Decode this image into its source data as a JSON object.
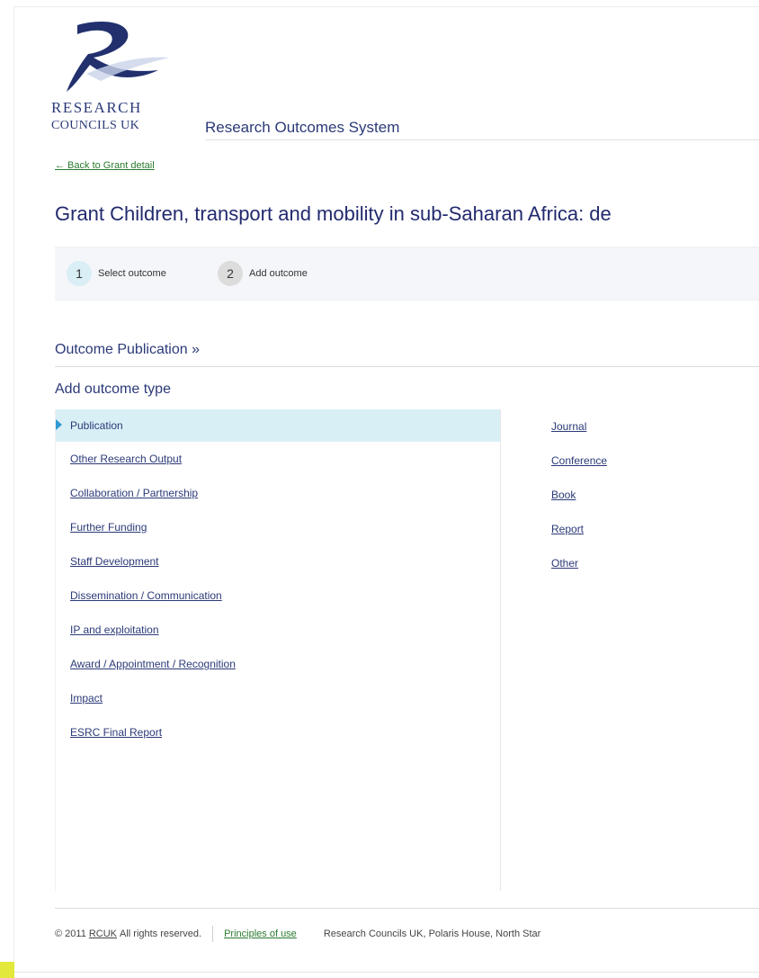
{
  "header": {
    "logo_line_1": "RESEARCH",
    "logo_line_2": "COUNCILS UK",
    "system_title": "Research Outcomes System",
    "logo_icon": "rcuk-swoosh-logo"
  },
  "nav": {
    "back_link": "← Back to Grant detail"
  },
  "grant": {
    "title": "Grant Children, transport and mobility in sub-Saharan Africa: de"
  },
  "steps": [
    {
      "number": "1",
      "label": "Select outcome"
    },
    {
      "number": "2",
      "label": "Add outcome"
    }
  ],
  "section": {
    "heading": "Outcome Publication »",
    "subheading": "Add outcome type"
  },
  "outcome_types": [
    {
      "label": "Publication",
      "selected": true
    },
    {
      "label": "Other Research Output",
      "selected": false
    },
    {
      "label": "Collaboration / Partnership",
      "selected": false
    },
    {
      "label": "Further Funding",
      "selected": false
    },
    {
      "label": "Staff Development",
      "selected": false
    },
    {
      "label": "Dissemination / Communication",
      "selected": false
    },
    {
      "label": "IP and exploitation",
      "selected": false
    },
    {
      "label": "Award / Appointment / Recognition",
      "selected": false
    },
    {
      "label": "Impact",
      "selected": false
    },
    {
      "label": "ESRC Final Report",
      "selected": false
    }
  ],
  "publication_subtypes": [
    "Journal",
    "Conference",
    "Book",
    "Report",
    "Other"
  ],
  "footer": {
    "copyright_prefix": "© 2011",
    "rcuk_link": "RCUK",
    "copyright_suffix": "All rights reserved.",
    "principles_link": "Principles of use",
    "address": "Research Councils UK, Polaris House, North Star"
  },
  "colors": {
    "brand_navy": "#2b3a78",
    "link_green": "#2a7a2f",
    "selected_bg": "#d9eff6",
    "pointer_blue": "#2f9ad3"
  }
}
